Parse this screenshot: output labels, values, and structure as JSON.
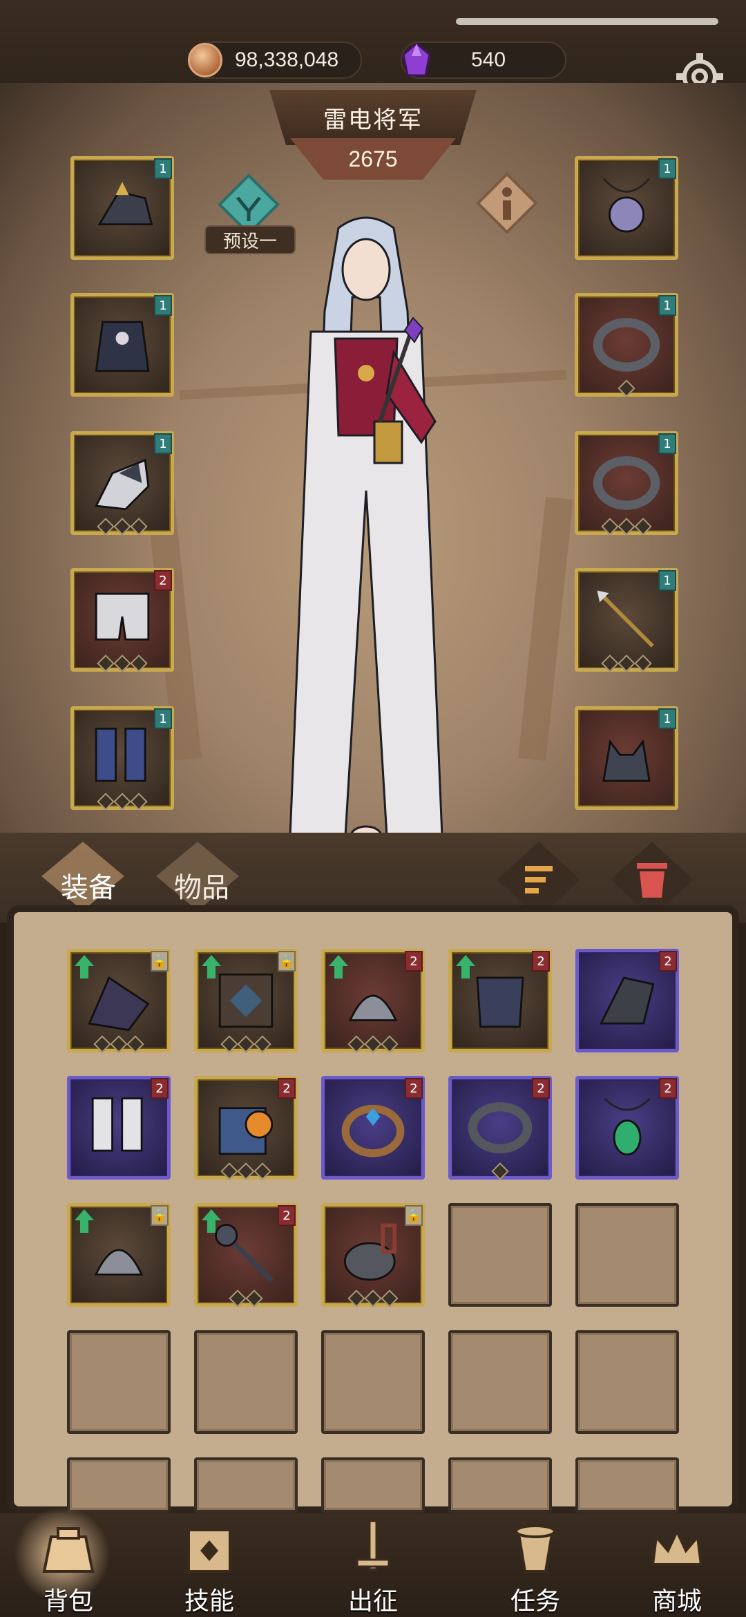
{
  "currencies": {
    "gold": "98,338,048",
    "gems": "540"
  },
  "character": {
    "name": "雷电将军",
    "power": "2675",
    "preset_label": "预设一"
  },
  "tabs": {
    "equipment": "装备",
    "items": "物品"
  },
  "nav": {
    "bag": "背包",
    "skills": "技能",
    "expedition": "出征",
    "tasks": "任务",
    "shop": "商城"
  },
  "slot_tags": {
    "one": "1",
    "two": "2"
  },
  "colors": {
    "gold_border": "#c9a94f",
    "purple_border": "#6d5ac9",
    "teal_tag": "#2f7c78",
    "red_tag": "#8b2d30",
    "accent_red": "#d9544f"
  },
  "icons": {
    "settings": "gear-icon",
    "preset": "preset-emblem-icon",
    "info": "info-icon",
    "sort": "sort-icon",
    "trash": "trash-icon"
  }
}
